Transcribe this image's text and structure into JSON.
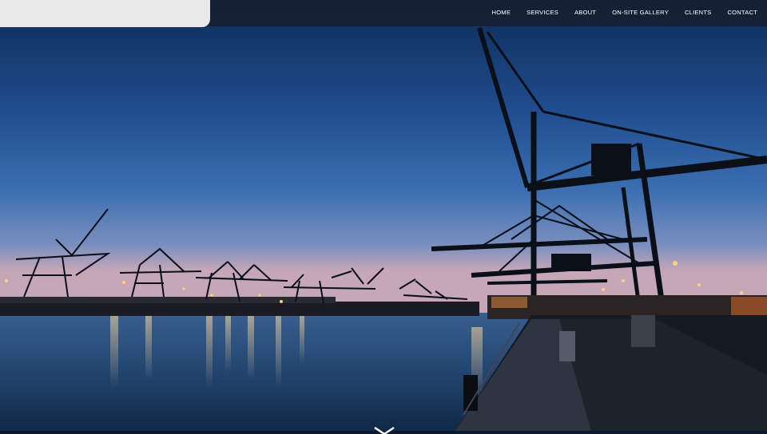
{
  "nav": {
    "items": [
      {
        "label": "HOME"
      },
      {
        "label": "SERVICES"
      },
      {
        "label": "ABOUT"
      },
      {
        "label": "ON-SITE GALLERY"
      },
      {
        "label": "CLIENTS"
      },
      {
        "label": "CONTACT"
      }
    ]
  },
  "hero": {
    "image": "port-cranes-at-dusk",
    "colors": {
      "sky_top": "#0e3263",
      "sky_mid": "#2d62a6",
      "horizon": "#b7a9c6",
      "water": "#23466e",
      "crane": "#0a0f18"
    }
  },
  "icons": {
    "scroll_down": "chevron-down-icon"
  }
}
